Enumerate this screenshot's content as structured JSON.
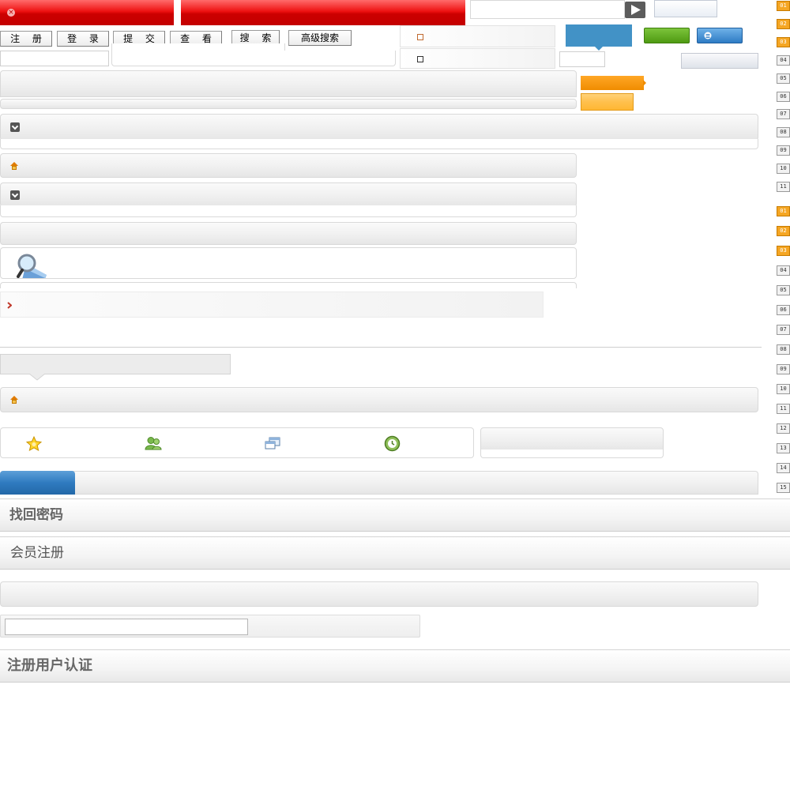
{
  "toolbar": {
    "buttons": [
      "注 册",
      "登 录",
      "提 交",
      "查 看",
      "搜 索",
      "高级搜索"
    ]
  },
  "sections": {
    "find_password": "找回密码",
    "member_register": "会员注册",
    "user_verify": "注册用户认证"
  },
  "page_numbers_top": {
    "items": [
      "01",
      "02",
      "03",
      "04",
      "05",
      "06",
      "07",
      "08",
      "09",
      "10",
      "11"
    ],
    "active_count": 3
  },
  "page_numbers_bottom": {
    "items": [
      "01",
      "02",
      "03",
      "04",
      "05",
      "06",
      "07",
      "08",
      "09",
      "10",
      "11",
      "12",
      "13",
      "14",
      "15"
    ],
    "active_count": 3
  },
  "colors": {
    "red": "#dd0000",
    "blue": "#4292c6",
    "green": "#5fa81f",
    "orange": "#ff9900",
    "tab_blue": "#2f7bc0"
  },
  "icons": {
    "search_submit": "play-arrow-icon",
    "close": "close-icon",
    "chevron": "chevron-down-icon",
    "home": "home-icon",
    "magnifier": "magnifier-icon",
    "star": "star-icon",
    "users": "users-icon",
    "windows": "windows-icon",
    "history": "history-icon"
  }
}
